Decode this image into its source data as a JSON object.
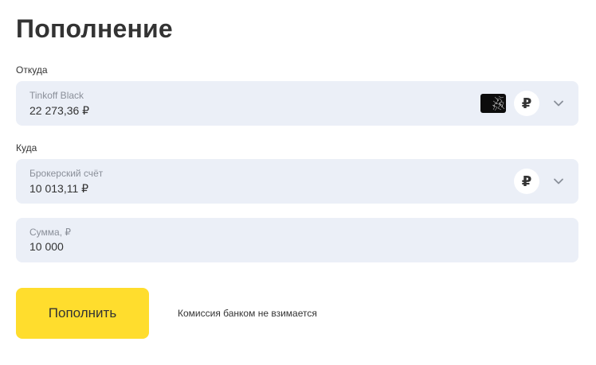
{
  "page": {
    "title": "Пополнение"
  },
  "from": {
    "label": "Откуда",
    "account_name": "Tinkoff Black",
    "balance": "22 273,36 ₽",
    "currency_symbol": "₽",
    "card_icon": "card-icon",
    "chevron_icon": "chevron-down-icon"
  },
  "to": {
    "label": "Куда",
    "account_name": "Брокерский счёт",
    "balance": "10 013,11 ₽",
    "currency_symbol": "₽",
    "chevron_icon": "chevron-down-icon"
  },
  "amount": {
    "caption": "Сумма, ₽",
    "value": "10 000"
  },
  "submit": {
    "label": "Пополнить"
  },
  "commission_note": "Комиссия банком не взимается",
  "colors": {
    "accent": "#ffdd2d",
    "field_background": "#ebeff7",
    "text": "#333333",
    "muted_text": "#8a8f99"
  }
}
